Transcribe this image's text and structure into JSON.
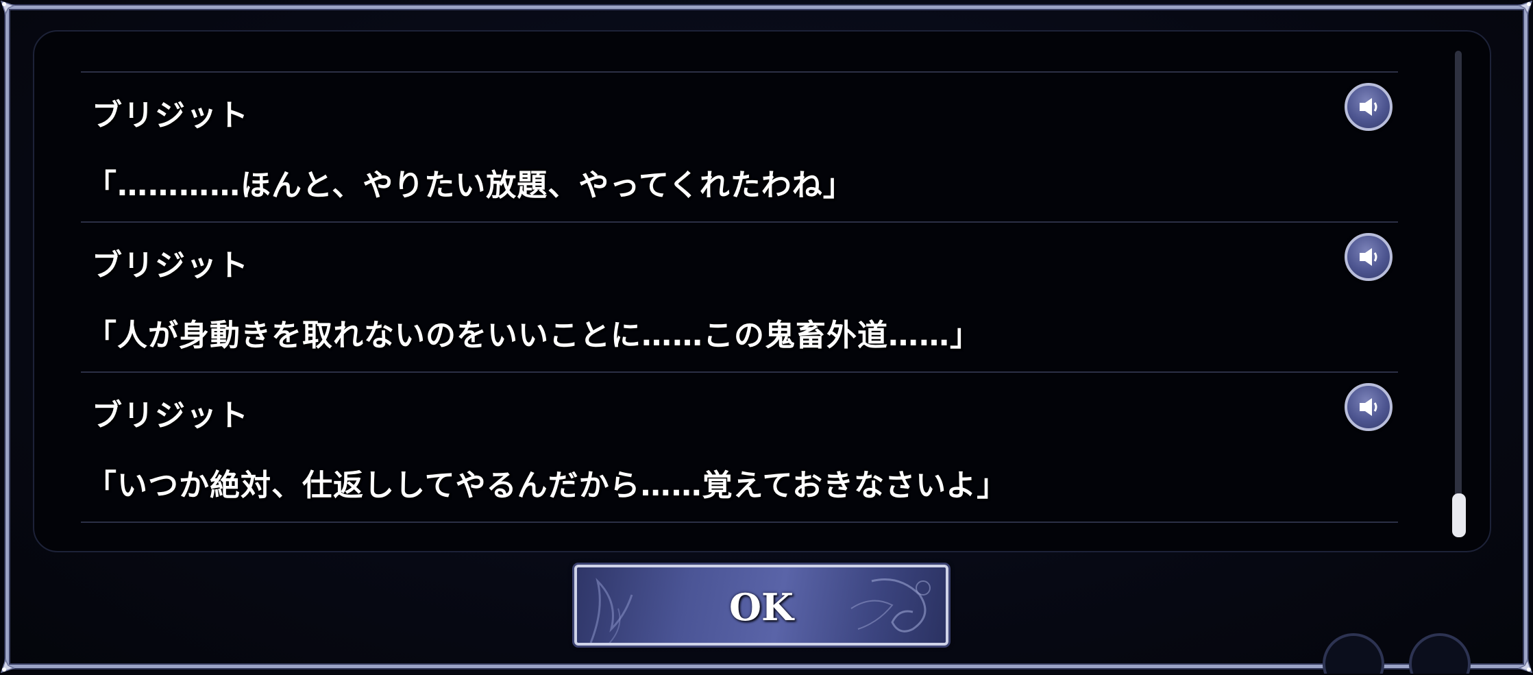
{
  "dialog": {
    "entries": [
      {
        "speaker": "ブリジット",
        "line": "「…………ほんと、やりたい放題、やってくれたわね」",
        "voice_icon": "speaker-icon"
      },
      {
        "speaker": "ブリジット",
        "line": "「人が身動きを取れないのをいいことに……この鬼畜外道……」",
        "voice_icon": "speaker-icon"
      },
      {
        "speaker": "ブリジット",
        "line": "「いつか絶対、仕返ししてやるんだから……覚えておきなさいよ」",
        "voice_icon": "speaker-icon"
      }
    ],
    "ok_label": "OK",
    "scroll_position": 1.0
  },
  "colors": {
    "frame_border": "#9ba3c6",
    "panel_bg": "#020308",
    "button_accent": "#4b5596",
    "text": "#ffffff"
  }
}
